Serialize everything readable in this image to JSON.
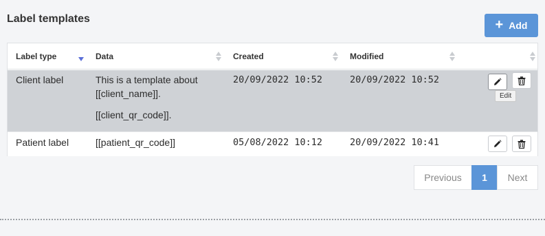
{
  "page": {
    "title": "Label templates"
  },
  "toolbar": {
    "add_label": "Add",
    "add_icon": "plus-icon"
  },
  "table": {
    "columns": [
      "Label type",
      "Data",
      "Created",
      "Modified"
    ],
    "sorted_column": "Label type",
    "rows": [
      {
        "label_type": "Client label",
        "data_line1": "This is a template about",
        "data_line2": "[[client_name]].",
        "data_line3": "[[client_qr_code]].",
        "created": "20/09/2022 10:52",
        "modified": "20/09/2022 10:52"
      },
      {
        "label_type": "Patient label",
        "data_line1": "[[patient_qr_code]]",
        "created": "05/08/2022 10:12",
        "modified": "20/09/2022 10:41"
      }
    ]
  },
  "tooltip": {
    "text": "Edit"
  },
  "pagination": {
    "previous": "Previous",
    "current": "1",
    "next": "Next"
  },
  "colors": {
    "accent": "#5b95d8",
    "highlight_row": "#cfd2d6",
    "sort_active": "#5b6fd8"
  }
}
